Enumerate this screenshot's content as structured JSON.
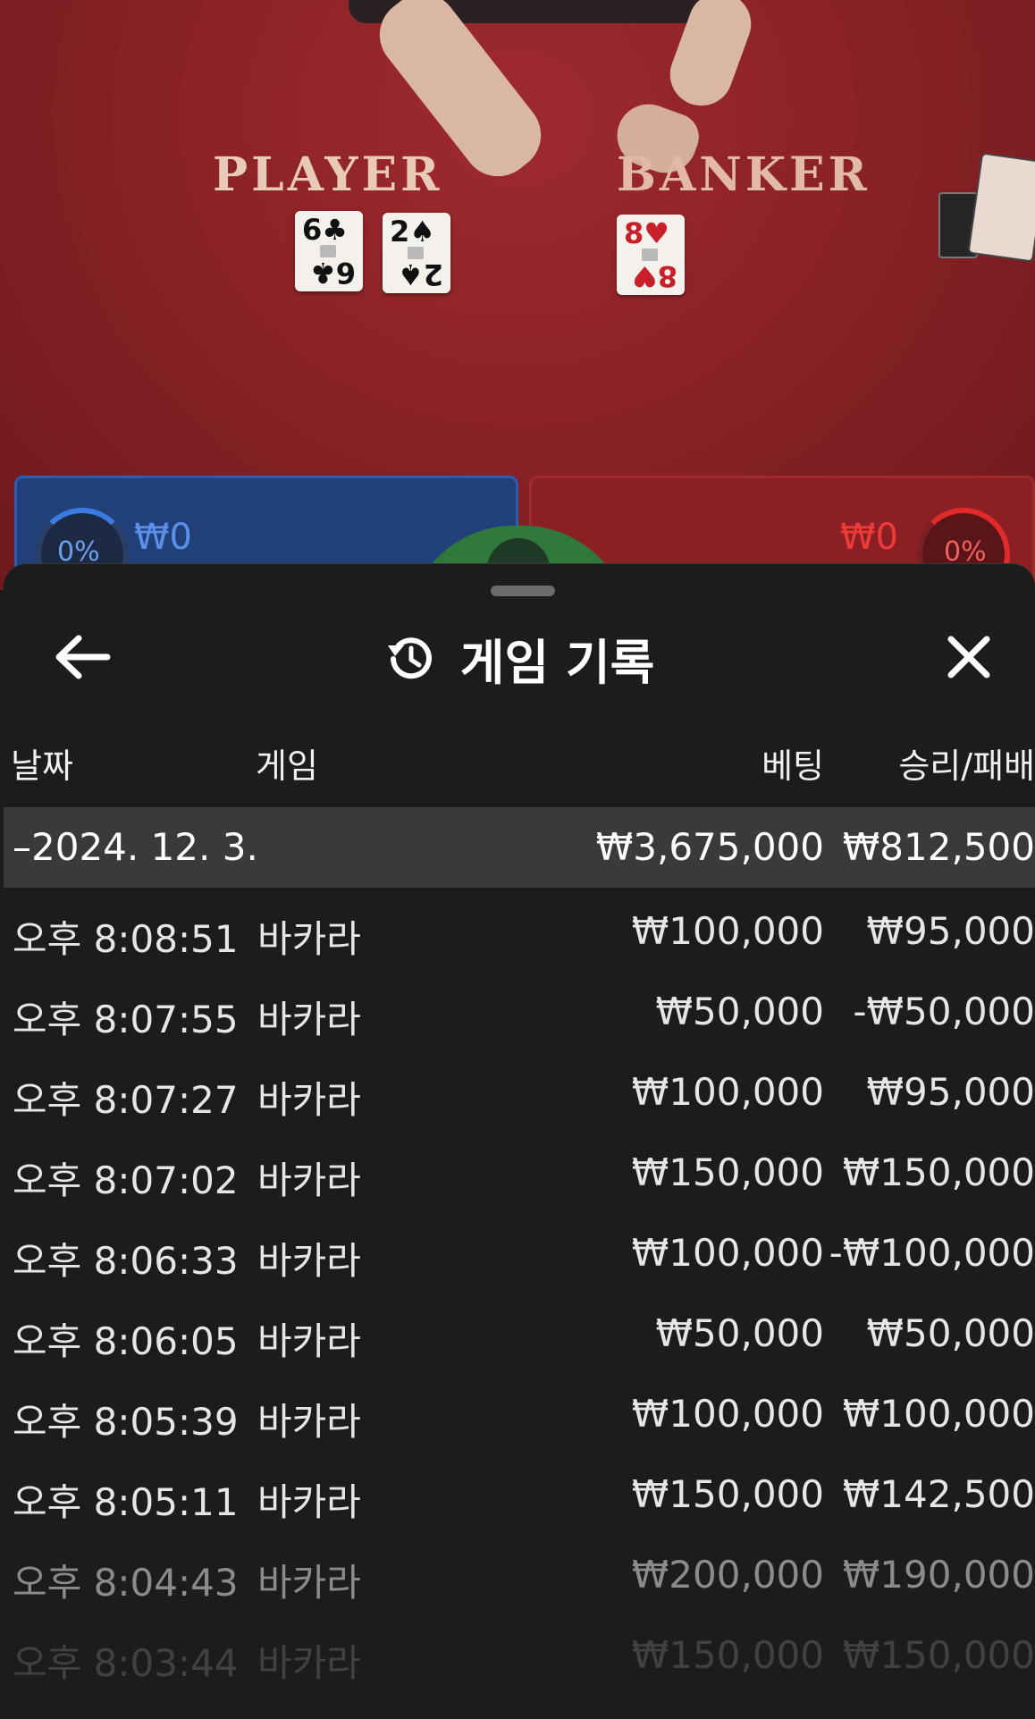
{
  "table": {
    "player_label": "PLAYER",
    "banker_label": "BANKER",
    "player_cards": [
      {
        "rank": "6",
        "suit": "♣",
        "color": "black"
      },
      {
        "rank": "2",
        "suit": "♠",
        "color": "black"
      }
    ],
    "banker_cards": [
      {
        "rank": "8",
        "suit": "♥",
        "color": "red"
      }
    ],
    "player_bet_amount": "₩0",
    "banker_bet_amount": "₩0",
    "player_percent": "0%",
    "banker_percent": "0%",
    "colors": {
      "player": "#2e5bb3",
      "banker": "#a12a2e",
      "tie": "#2f7a3b"
    }
  },
  "sheet": {
    "title": "게임 기록",
    "icons": {
      "back": "arrow-left-icon",
      "title": "history-icon",
      "close": "close-icon"
    },
    "columns": {
      "date": "날짜",
      "game": "게임",
      "bet": "베팅",
      "result": "승리/패배"
    },
    "summary": {
      "date": "–2024. 12. 3.",
      "bet": "₩3,675,000",
      "result": "₩812,500"
    },
    "rows": [
      {
        "time": "오후 8:08:51",
        "game": "바카라",
        "bet": "₩100,000",
        "result": "₩95,000"
      },
      {
        "time": "오후 8:07:55",
        "game": "바카라",
        "bet": "₩50,000",
        "result": "-₩50,000"
      },
      {
        "time": "오후 8:07:27",
        "game": "바카라",
        "bet": "₩100,000",
        "result": "₩95,000"
      },
      {
        "time": "오후 8:07:02",
        "game": "바카라",
        "bet": "₩150,000",
        "result": "₩150,000"
      },
      {
        "time": "오후 8:06:33",
        "game": "바카라",
        "bet": "₩100,000",
        "result": "-₩100,000"
      },
      {
        "time": "오후 8:06:05",
        "game": "바카라",
        "bet": "₩50,000",
        "result": "₩50,000"
      },
      {
        "time": "오후 8:05:39",
        "game": "바카라",
        "bet": "₩100,000",
        "result": "₩100,000"
      },
      {
        "time": "오후 8:05:11",
        "game": "바카라",
        "bet": "₩150,000",
        "result": "₩142,500"
      },
      {
        "time": "오후 8:04:43",
        "game": "바카라",
        "bet": "₩200,000",
        "result": "₩190,000"
      },
      {
        "time": "오후 8:03:44",
        "game": "바카라",
        "bet": "₩150,000",
        "result": "₩150,000"
      }
    ]
  }
}
